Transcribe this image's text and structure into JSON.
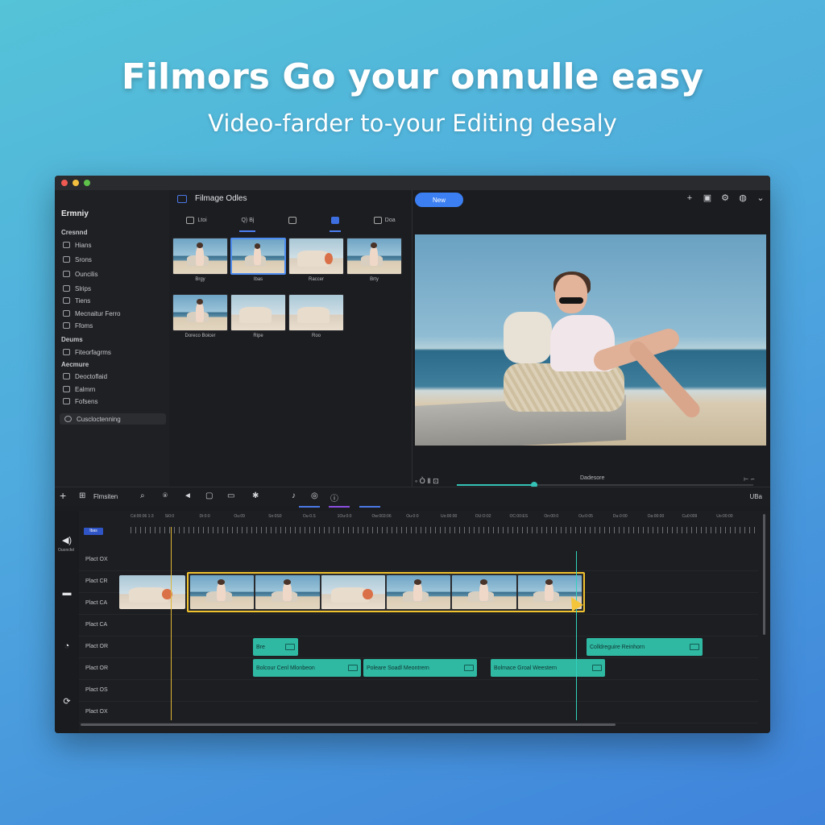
{
  "hero": {
    "title": "Filmors Go your onnulle easy",
    "subtitle": "Video-farder to-your Editing desaly"
  },
  "app": {
    "title": "Ermniy",
    "panel_title": "Filmage Odles"
  },
  "sidebar": {
    "group1": "Cresnnd",
    "items1": [
      {
        "label": "Hians",
        "icon": "home-icon"
      },
      {
        "label": "Srons",
        "icon": "share-icon"
      },
      {
        "label": "Ouncilis",
        "icon": "bookmark-icon"
      },
      {
        "label": "Slrips",
        "icon": "layers-icon"
      },
      {
        "label": "Tiens",
        "icon": "clock-icon"
      },
      {
        "label": "Mecnaitur Ferro",
        "icon": "film-icon"
      },
      {
        "label": "Ffoms",
        "icon": "folder-icon"
      }
    ],
    "group2": "Deums",
    "items2": [
      {
        "label": "Fiteorfagrms",
        "icon": "grid-icon"
      }
    ],
    "group3": "Aecmure",
    "items3": [
      {
        "label": "Deoctoflaid",
        "icon": "list-icon"
      },
      {
        "label": "Ealmrn",
        "icon": "gallery-icon"
      },
      {
        "label": "Fofsens",
        "icon": "document-icon"
      }
    ],
    "selected_item": "Cuscloctenning"
  },
  "media": {
    "tabs": [
      {
        "label": "Ltoi",
        "icon": "media-icon"
      },
      {
        "label": "Q) Bj",
        "icon": "audio-icon"
      },
      {
        "label": "",
        "icon": "titles-icon"
      },
      {
        "label": "",
        "icon": "effects-icon"
      },
      {
        "label": "Doa",
        "icon": "elements-icon"
      }
    ],
    "thumbnails": [
      {
        "label": "Brgy"
      },
      {
        "label": "Ibas"
      },
      {
        "label": "Raccer"
      },
      {
        "label": "Brty"
      },
      {
        "label": "Doreco Boicer"
      },
      {
        "label": "Ripe"
      },
      {
        "label": "Roo"
      }
    ]
  },
  "toolbar": {
    "new_label": "New",
    "top_icons": [
      "plus-icon",
      "image-icon",
      "settings-icon",
      "globe-icon",
      "chevron-down-icon"
    ]
  },
  "playback": {
    "controls": "◦ Ò Ⅱ ⊡",
    "label": "Dadesore",
    "end": "⊢ ∽",
    "progress": 0.26
  },
  "timeline_toolbar": {
    "add": "+",
    "filters_label": "Flmsiten",
    "right_label": "UBa",
    "tab_colors": [
      "#4b79e8",
      "#8a4fe0",
      "#4b79e8"
    ]
  },
  "timeline": {
    "left_labels": [
      "Ouoncfel"
    ],
    "badge": "Ibas",
    "ruler": [
      "Cd:00:06 1:3",
      "Si0:0",
      "Di:0:0",
      "Ou:09",
      "Sn:0S0",
      "Ou-0.S",
      "1Ou:0:0",
      "Ow:003:06",
      "Ou-0:0",
      "Uo:00:00",
      "OU:O:02",
      "OC:00:ES",
      "On:00:0",
      "Ou:0:05",
      "Du-0:00",
      "Oa:00:00",
      "Cu0:009",
      "Uo:00:00"
    ],
    "tracks": [
      "Plact OX",
      "Plact CR",
      "Plact CA",
      "Plact CA",
      "Plact OR",
      "Plact OR",
      "Plact OS",
      "Plact OX"
    ],
    "captions": [
      {
        "text": "Bre"
      },
      {
        "text": "Bolcour Cenl Mlonbeon"
      },
      {
        "text": "Poleare Soadl Meontrern"
      },
      {
        "text": "Bolmace Groal Weestern"
      },
      {
        "text": "Colldreguire Reinhorn"
      }
    ],
    "accent_playhead": "#e0b634",
    "caption_color": "#2fb8a2"
  }
}
